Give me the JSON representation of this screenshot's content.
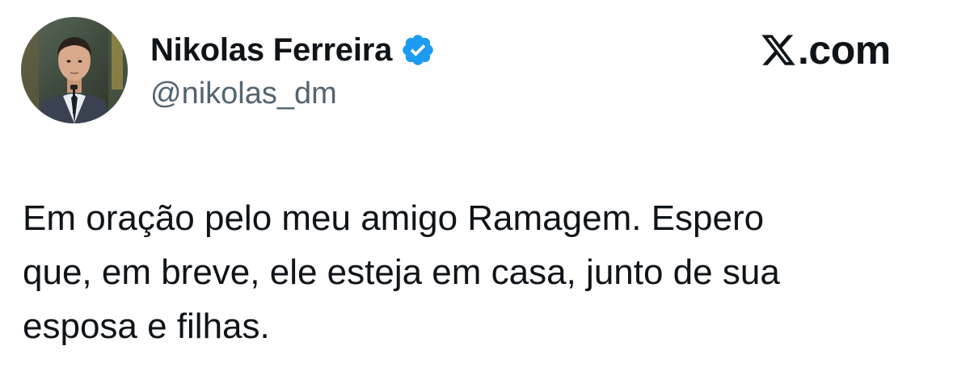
{
  "author": {
    "display_name": "Nikolas Ferreira",
    "handle": "@nikolas_dm",
    "verified_icon": "verified-badge-icon",
    "avatar_icon": "profile-avatar"
  },
  "brand": {
    "logo_icon": "x-logo-icon",
    "suffix": ".com"
  },
  "tweet": {
    "text": "Em oração pelo meu amigo Ramagem. Espero\nque, em breve, ele esteja em casa, junto de sua\nesposa e filhas."
  },
  "colors": {
    "text_primary": "#0f1419",
    "text_secondary": "#536471",
    "verified_blue": "#1d9bf0",
    "background": "#ffffff"
  }
}
